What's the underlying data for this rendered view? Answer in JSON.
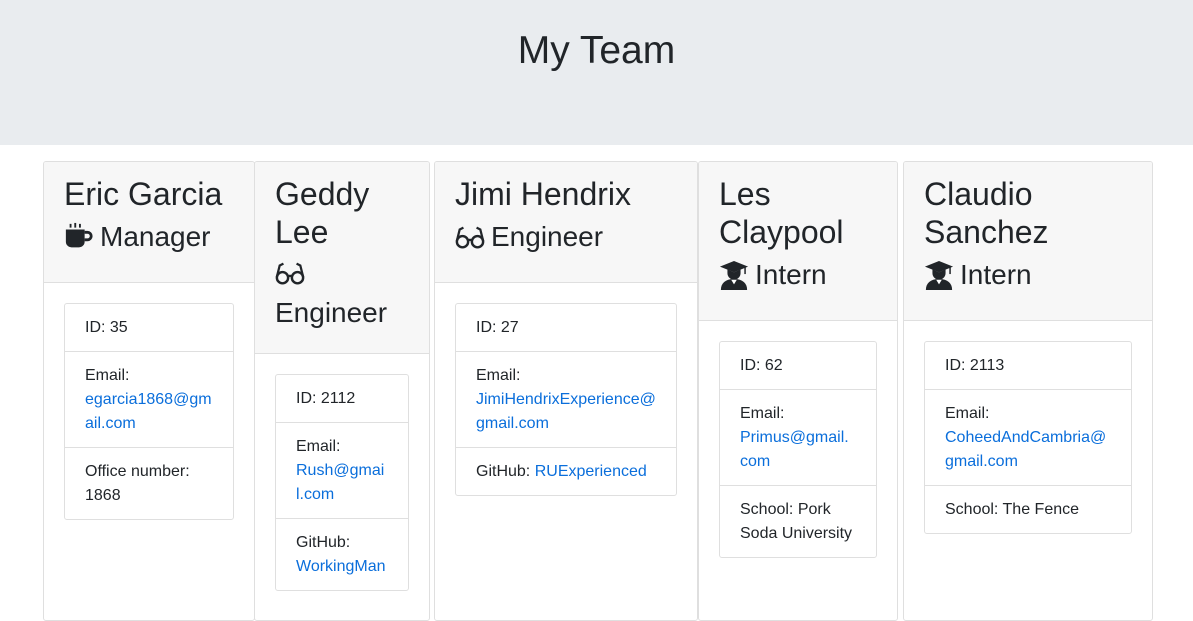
{
  "page": {
    "title": "My Team"
  },
  "members": [
    {
      "name": "Eric Garcia",
      "role": "Manager",
      "role_icon": "coffee-icon",
      "id_label": "ID: 35",
      "email_label": "Email:",
      "email": "egarcia1868@gmail.com",
      "extra_label": "Office number:",
      "extra_value": "1868"
    },
    {
      "name": "Geddy Lee",
      "role": "Engineer",
      "role_icon": "glasses-icon",
      "id_label": "ID: 2112",
      "email_label": "Email:",
      "email": "Rush@gmail.com",
      "extra_label": "GitHub:",
      "extra_value": "WorkingMan"
    },
    {
      "name": "Jimi Hendrix",
      "role": "Engineer",
      "role_icon": "glasses-icon",
      "id_label": "ID: 27",
      "email_label": "Email:",
      "email": "JimiHendrixExperience@gmail.com",
      "extra_label": "GitHub:",
      "extra_value": "RUExperienced"
    },
    {
      "name": "Les Claypool",
      "role": "Intern",
      "role_icon": "graduate-icon",
      "id_label": "ID: 62",
      "email_label": "Email:",
      "email": "Primus@gmail.com",
      "extra_label": "School:",
      "extra_value": "Pork Soda University"
    },
    {
      "name": "Claudio Sanchez",
      "role": "Intern",
      "role_icon": "graduate-icon",
      "id_label": "ID: 2113",
      "email_label": "Email:",
      "email": "CoheedAndCambria@gmail.com",
      "extra_label": "School:",
      "extra_value": "The Fence"
    }
  ],
  "colors": {
    "header_bg": "#e9ecef",
    "card_header_bg": "#f7f7f7",
    "link": "#0a6edb"
  }
}
